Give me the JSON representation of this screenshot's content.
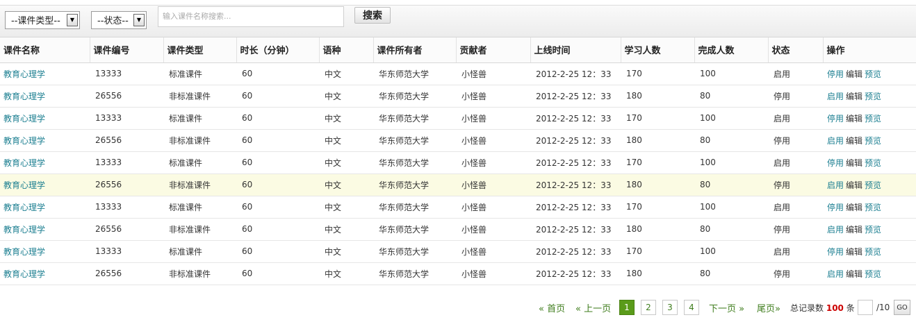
{
  "toolbar": {
    "type_select": "--课件类型--",
    "status_select": "--状态--",
    "search_placeholder": "输入课件名称搜索...",
    "search_button": "搜索"
  },
  "table": {
    "headers": [
      "课件名称",
      "课件编号",
      "课件类型",
      "时长（分钟）",
      "语种",
      "课件所有者",
      "贡献者",
      "上线时间",
      "学习人数",
      "完成人数",
      "状态",
      "操作"
    ],
    "rows": [
      {
        "name": "教育心理学",
        "code": "13333",
        "type": "标准课件",
        "duration": "60",
        "lang": "中文",
        "owner": "华东师范大学",
        "contributor": "小怪兽",
        "online": "2012-2-25 12：33",
        "learners": "170",
        "completed": "100",
        "status": "启用",
        "op1": "停用",
        "op2": "编辑",
        "op3": "预览"
      },
      {
        "name": "教育心理学",
        "code": "26556",
        "type": "非标准课件",
        "duration": "60",
        "lang": "中文",
        "owner": "华东师范大学",
        "contributor": "小怪兽",
        "online": "2012-2-25 12：33",
        "learners": "180",
        "completed": "80",
        "status": "停用",
        "op1": "启用",
        "op2": "编辑",
        "op3": "预览"
      },
      {
        "name": "教育心理学",
        "code": "13333",
        "type": "标准课件",
        "duration": "60",
        "lang": "中文",
        "owner": "华东师范大学",
        "contributor": "小怪兽",
        "online": "2012-2-25 12：33",
        "learners": "170",
        "completed": "100",
        "status": "启用",
        "op1": "停用",
        "op2": "编辑",
        "op3": "预览"
      },
      {
        "name": "教育心理学",
        "code": "26556",
        "type": "非标准课件",
        "duration": "60",
        "lang": "中文",
        "owner": "华东师范大学",
        "contributor": "小怪兽",
        "online": "2012-2-25 12：33",
        "learners": "180",
        "completed": "80",
        "status": "停用",
        "op1": "启用",
        "op2": "编辑",
        "op3": "预览"
      },
      {
        "name": "教育心理学",
        "code": "13333",
        "type": "标准课件",
        "duration": "60",
        "lang": "中文",
        "owner": "华东师范大学",
        "contributor": "小怪兽",
        "online": "2012-2-25 12：33",
        "learners": "170",
        "completed": "100",
        "status": "启用",
        "op1": "停用",
        "op2": "编辑",
        "op3": "预览"
      },
      {
        "name": "教育心理学",
        "code": "26556",
        "type": "非标准课件",
        "duration": "60",
        "lang": "中文",
        "owner": "华东师范大学",
        "contributor": "小怪兽",
        "online": "2012-2-25 12：33",
        "learners": "180",
        "completed": "80",
        "status": "停用",
        "op1": "启用",
        "op2": "编辑",
        "op3": "预览"
      },
      {
        "name": "教育心理学",
        "code": "13333",
        "type": "标准课件",
        "duration": "60",
        "lang": "中文",
        "owner": "华东师范大学",
        "contributor": "小怪兽",
        "online": "2012-2-25 12：33",
        "learners": "170",
        "completed": "100",
        "status": "启用",
        "op1": "停用",
        "op2": "编辑",
        "op3": "预览"
      },
      {
        "name": "教育心理学",
        "code": "26556",
        "type": "非标准课件",
        "duration": "60",
        "lang": "中文",
        "owner": "华东师范大学",
        "contributor": "小怪兽",
        "online": "2012-2-25 12：33",
        "learners": "180",
        "completed": "80",
        "status": "停用",
        "op1": "启用",
        "op2": "编辑",
        "op3": "预览"
      },
      {
        "name": "教育心理学",
        "code": "13333",
        "type": "标准课件",
        "duration": "60",
        "lang": "中文",
        "owner": "华东师范大学",
        "contributor": "小怪兽",
        "online": "2012-2-25 12：33",
        "learners": "170",
        "completed": "100",
        "status": "启用",
        "op1": "停用",
        "op2": "编辑",
        "op3": "预览"
      },
      {
        "name": "教育心理学",
        "code": "26556",
        "type": "非标准课件",
        "duration": "60",
        "lang": "中文",
        "owner": "华东师范大学",
        "contributor": "小怪兽",
        "online": "2012-2-25 12：33",
        "learners": "180",
        "completed": "80",
        "status": "停用",
        "op1": "启用",
        "op2": "编辑",
        "op3": "预览"
      }
    ]
  },
  "pager": {
    "first": "« 首页",
    "prev": "« 上一页",
    "pages": [
      "1",
      "2",
      "3",
      "4"
    ],
    "current": "1",
    "next": "下一页 »",
    "last": "尾页»",
    "total_label": "总记录数",
    "total": "100",
    "unit": "条",
    "page_count": "/10",
    "go": "GO"
  },
  "colors": {
    "link": "#1c7f91",
    "pager_active": "#5a9b1a",
    "total_red": "#cc0000",
    "highlight_row": "#fbfbe3"
  }
}
